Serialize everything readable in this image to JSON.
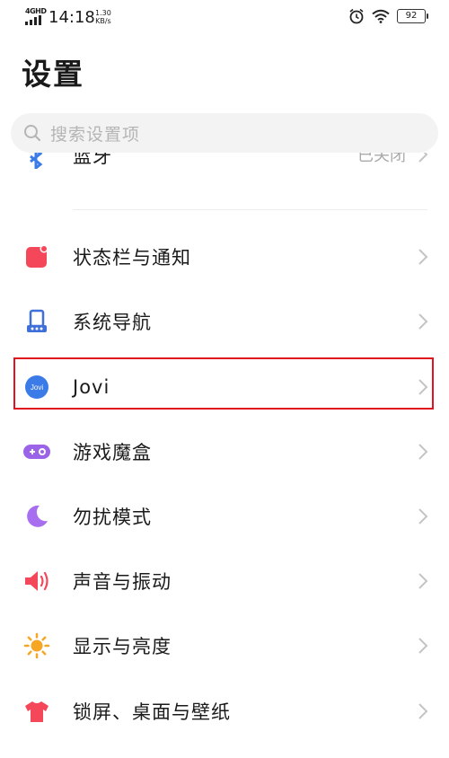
{
  "status_bar": {
    "network": "4GHD",
    "time": "14:18",
    "speed_value": "1.30",
    "speed_unit": "KB/s",
    "battery": "92"
  },
  "page": {
    "title": "设置"
  },
  "search": {
    "placeholder": "搜索设置项"
  },
  "partial_item": {
    "label": "蓝牙",
    "value": "已关闭"
  },
  "items": [
    {
      "label": "状态栏与通知",
      "icon": "notification-icon",
      "color": "#f5475a"
    },
    {
      "label": "系统导航",
      "icon": "navigation-icon",
      "color": "#3f6fd8"
    },
    {
      "label": "Jovi",
      "icon": "jovi-icon",
      "color": "#3b7be8"
    },
    {
      "label": "游戏魔盒",
      "icon": "gamepad-icon",
      "color": "#9b63e8"
    },
    {
      "label": "勿扰模式",
      "icon": "moon-icon",
      "color": "#a86ef0"
    },
    {
      "label": "声音与振动",
      "icon": "speaker-icon",
      "color": "#f5475a"
    },
    {
      "label": "显示与亮度",
      "icon": "sun-icon",
      "color": "#f6a623"
    },
    {
      "label": "锁屏、桌面与壁纸",
      "icon": "shirt-icon",
      "color": "#f5475a"
    }
  ],
  "jovi_icon_text": "Jovi",
  "highlight_color": "#e0131f"
}
